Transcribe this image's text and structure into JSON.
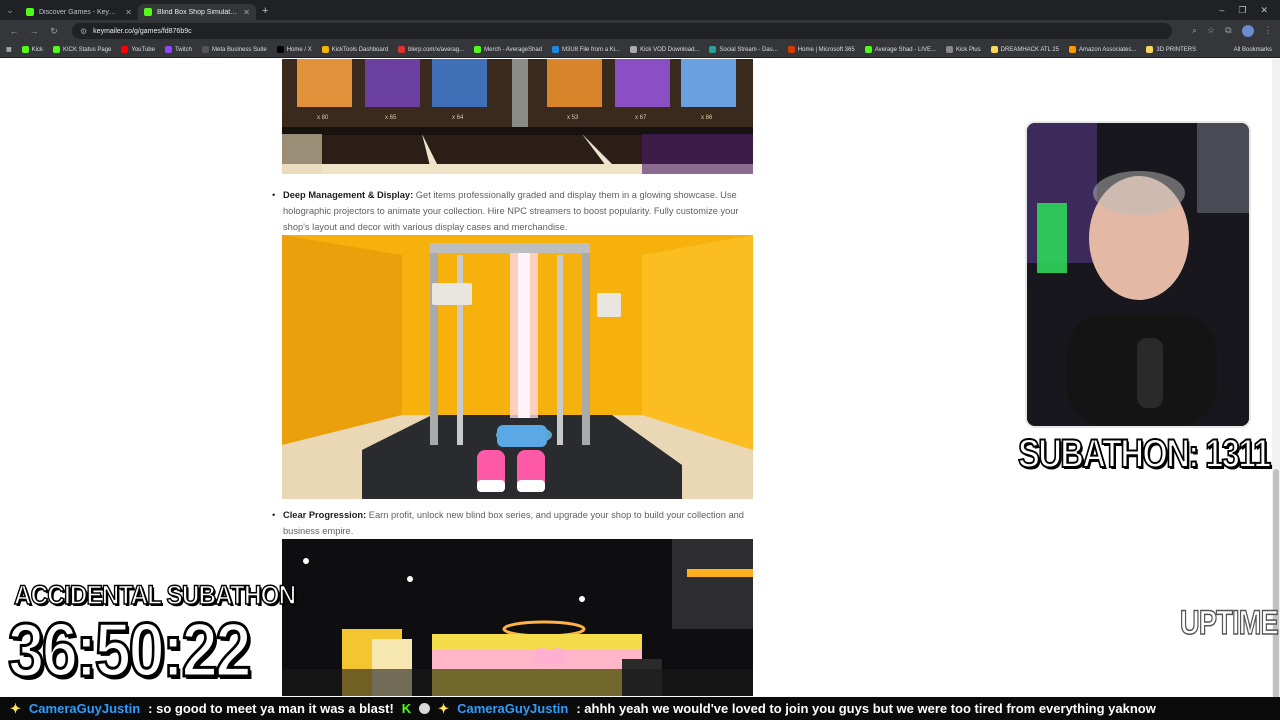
{
  "browser": {
    "tabs": [
      {
        "title": "Discover Games - Keymailer",
        "active": false
      },
      {
        "title": "Blind Box Shop Simulator - Key",
        "active": true
      }
    ],
    "url": "keymailer.co/g/games/fd876b9c",
    "bookmarks": [
      {
        "label": "Kick",
        "color": "#53fc18"
      },
      {
        "label": "KICK Status Page",
        "color": "#53fc18"
      },
      {
        "label": "YouTube",
        "color": "#ff0000"
      },
      {
        "label": "Twitch",
        "color": "#9146ff"
      },
      {
        "label": "Meta Business Suite",
        "color": "#555555"
      },
      {
        "label": "Home / X",
        "color": "#000000"
      },
      {
        "label": "KickTools Dashboard",
        "color": "#f5b400"
      },
      {
        "label": "blerp.com/x/averag...",
        "color": "#e03131"
      },
      {
        "label": "Merch - AverageShad",
        "color": "#53fc18"
      },
      {
        "label": "M3U8 File from a Ki...",
        "color": "#1e88e5"
      },
      {
        "label": "Kick VOD Download...",
        "color": "#aaaaaa"
      },
      {
        "label": "Social Stream - Das...",
        "color": "#2aa198"
      },
      {
        "label": "Home | Microsoft 365",
        "color": "#d83b01"
      },
      {
        "label": "Average Shad - LIVE...",
        "color": "#53fc18"
      },
      {
        "label": "Kick Plus",
        "color": "#888888"
      },
      {
        "label": "DREAMHACK ATL 25",
        "color": "#f9d65c"
      },
      {
        "label": "Amazon Associates...",
        "color": "#ff9900"
      },
      {
        "label": "3D PRINTERS",
        "color": "#f9d65c"
      }
    ],
    "all_bookmarks_label": "All Bookmarks"
  },
  "content": {
    "image1_counts": [
      "x 80",
      "x 65",
      "x 64",
      "x 53",
      "x 67",
      "x 86"
    ],
    "bullet1": {
      "label": "Deep Management & Display:",
      "text": " Get items professionally graded and display them in a glowing showcase. Use holographic projectors to animate your collection. Hire NPC streamers to boost popularity. Fully customize your shop's layout and decor with various display cases and merchandise."
    },
    "bullet2": {
      "label": "Clear Progression:",
      "text": " Earn profit, unlock new blind box series, and upgrade your shop to build your collection and business empire."
    }
  },
  "overlay": {
    "subathon_label": "SUBATHON: 1311",
    "accidental_label": "ACCIDENTAL SUBATHON",
    "timer": "36:50:22",
    "uptime_label": "UPTIME"
  },
  "chat": [
    {
      "user": "CameraGuyJustin",
      "message": ": so good to meet ya man it was a blast!"
    },
    {
      "user": "CameraGuyJustin",
      "message": ": ahhh yeah we would've loved to join you guys but we were too tired from everything yaknow"
    }
  ]
}
